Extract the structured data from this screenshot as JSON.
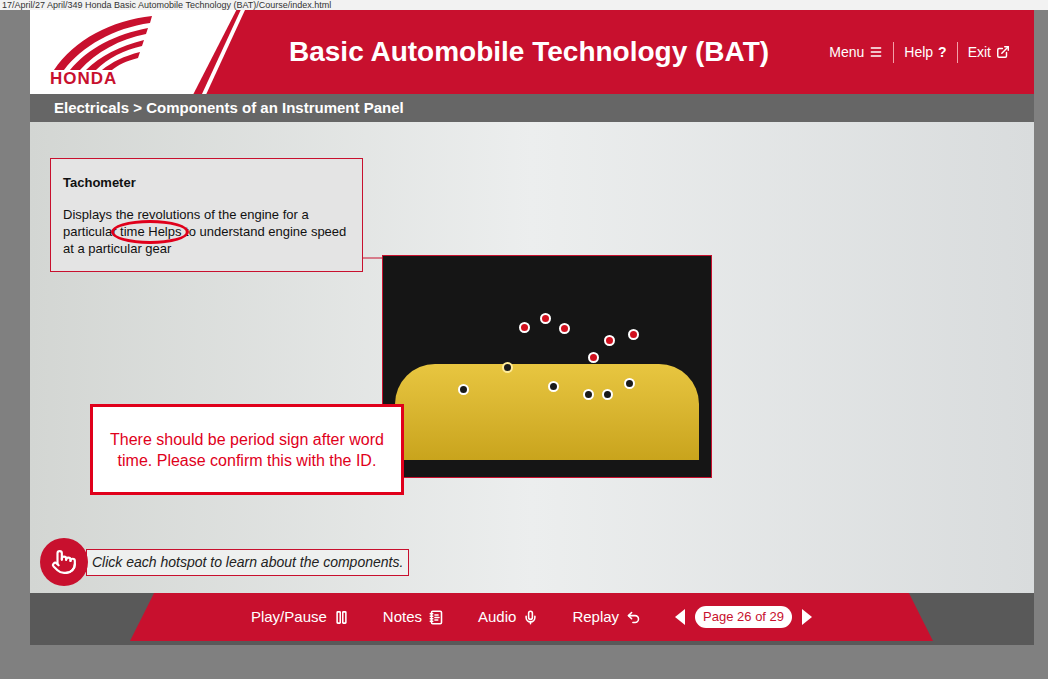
{
  "address_bar": {
    "text": "17/April/27 April/349 Honda Basic Automobile Technology (BAT)/Course/index.html"
  },
  "header": {
    "logo": "HONDA",
    "title": "Basic Automobile Technology (BAT)",
    "links": [
      {
        "label": "Menu"
      },
      {
        "label": "Help",
        "glyph": "?"
      },
      {
        "label": "Exit"
      }
    ]
  },
  "breadcrumb": "Electricals > Components of an Instrument Panel",
  "popup": {
    "title": "Tachometer",
    "segments": [
      {
        "text": "Displays the revolutions of the engine for a particular ",
        "circled": false
      },
      {
        "text": "time Helps",
        "circled": true
      },
      {
        "text": " to understand engine speed at a particular gear",
        "circled": false
      }
    ]
  },
  "hotspots": [
    {
      "color": "#d0101e",
      "selected": false
    },
    {
      "color": "#d0101e",
      "selected": false
    },
    {
      "color": "#d0101e",
      "selected": false
    },
    {
      "color": "#d0101e",
      "selected": false
    },
    {
      "color": "#d0101e",
      "selected": false
    },
    {
      "color": "#d0101e",
      "selected": false
    },
    {
      "color": "#1a1a1a",
      "selected": true
    },
    {
      "color": "#1a1a1a",
      "selected": false
    },
    {
      "color": "#1a1a1a",
      "selected": false
    },
    {
      "color": "#1a1a1a",
      "selected": false
    },
    {
      "color": "#1a1a1a",
      "selected": false
    },
    {
      "color": "#1a1a1a",
      "selected": false
    }
  ],
  "annotation": "There should be period sign after word time. Please confirm this with the ID.",
  "instruction": "Click each hotspot to learn about the components.",
  "footer": {
    "controls": [
      "Play/Pause",
      "Notes",
      "Audio",
      "Replay"
    ],
    "page": "Page 26 of 29"
  }
}
